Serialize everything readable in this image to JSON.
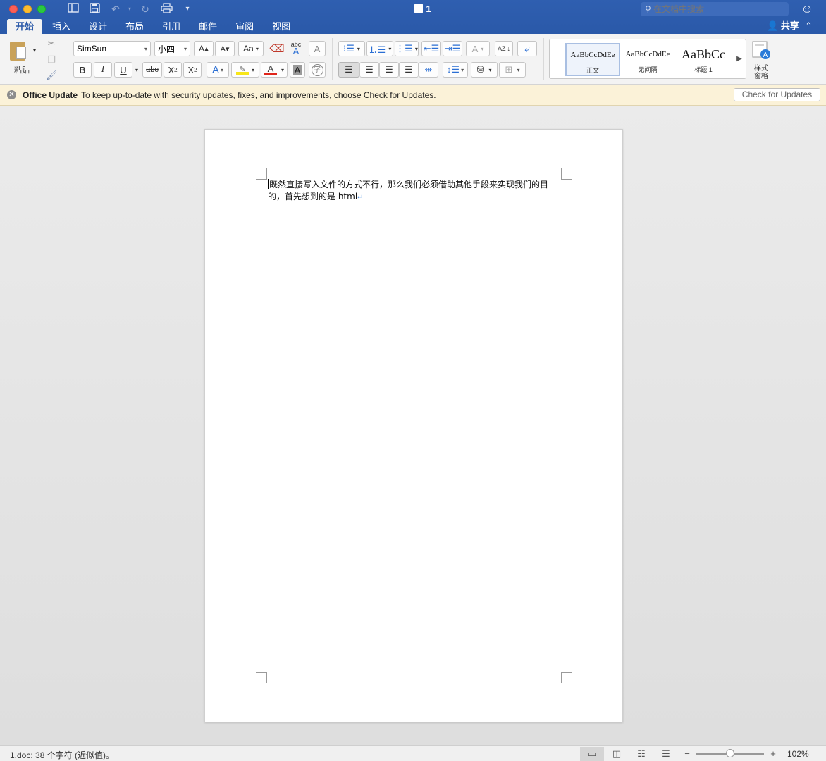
{
  "titlebar": {
    "doc_title": "1",
    "search_placeholder": "在文档中搜索",
    "share_label": "共享"
  },
  "tabs": [
    {
      "label": "开始",
      "active": true
    },
    {
      "label": "插入"
    },
    {
      "label": "设计"
    },
    {
      "label": "布局"
    },
    {
      "label": "引用"
    },
    {
      "label": "邮件"
    },
    {
      "label": "审阅"
    },
    {
      "label": "视图"
    }
  ],
  "ribbon": {
    "paste_label": "粘贴",
    "font_name": "SimSun",
    "font_size": "小四",
    "change_case_glyph": "Aa",
    "spell_glyph": "abc",
    "clear_format_glyph": "A",
    "bold": "B",
    "italic": "I",
    "underline": "U",
    "strike": "abc",
    "subscript": "X",
    "subscript_mark": "2",
    "superscript": "X",
    "superscript_mark": "2",
    "text_effect_glyph": "A",
    "font_color_glyph": "A",
    "char_shading_glyph": "A",
    "enclose_glyph": "字",
    "sort_glyph": "AZ",
    "styles": [
      {
        "sample": "AaBbCcDdEe",
        "name": "正文",
        "selected": true
      },
      {
        "sample": "AaBbCcDdEe",
        "name": "无间隔"
      },
      {
        "sample": "AaBbCc",
        "name": "标题 1"
      }
    ],
    "styles_pane_label_1": "样式",
    "styles_pane_label_2": "窗格",
    "accent_color": "#2b5797"
  },
  "banner": {
    "title": "Office Update",
    "message": "To keep up-to-date with security updates, fixes, and improvements, choose Check for Updates.",
    "button": "Check for Updates"
  },
  "document": {
    "line1": "既然直接写入文件的方式不行，那么我们必须借助其他手段来实现我们的目",
    "line2": "的，首先想到的是 html",
    "para_mark": "↵"
  },
  "status": {
    "left_text": "1.doc: 38 个字符 (近似值)。",
    "zoom_level": "102%"
  }
}
